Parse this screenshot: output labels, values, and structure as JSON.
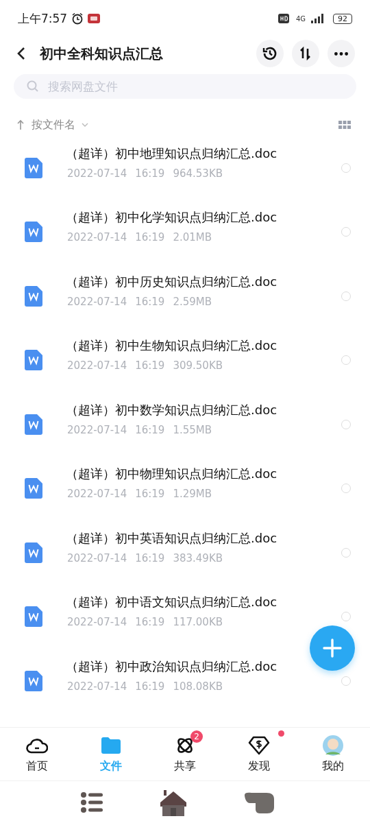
{
  "status_bar": {
    "time": "上午7:57",
    "network": "4G",
    "battery": "92"
  },
  "header": {
    "title": "初中全科知识点汇总"
  },
  "search": {
    "placeholder": "搜索网盘文件"
  },
  "sort": {
    "label": "按文件名"
  },
  "files": [
    {
      "name": "（超详）初中地理知识点归纳汇总.doc",
      "date": "2022-07-14",
      "time": "16:19",
      "size": "964.53KB",
      "selected": false
    },
    {
      "name": "（超详）初中化学知识点归纳汇总.doc",
      "date": "2022-07-14",
      "time": "16:19",
      "size": "2.01MB",
      "selected": false
    },
    {
      "name": "（超详）初中历史知识点归纳汇总.doc",
      "date": "2022-07-14",
      "time": "16:19",
      "size": "2.59MB",
      "selected": false
    },
    {
      "name": "（超详）初中生物知识点归纳汇总.doc",
      "date": "2022-07-14",
      "time": "16:19",
      "size": "309.50KB",
      "selected": false
    },
    {
      "name": "（超详）初中数学知识点归纳汇总.doc",
      "date": "2022-07-14",
      "time": "16:19",
      "size": "1.55MB",
      "selected": false
    },
    {
      "name": "（超详）初中物理知识点归纳汇总.doc",
      "date": "2022-07-14",
      "time": "16:19",
      "size": "1.29MB",
      "selected": false
    },
    {
      "name": "（超详）初中英语知识点归纳汇总.doc",
      "date": "2022-07-14",
      "time": "16:19",
      "size": "383.49KB",
      "selected": false
    },
    {
      "name": "（超详）初中语文知识点归纳汇总.doc",
      "date": "2022-07-14",
      "time": "16:19",
      "size": "117.00KB",
      "selected": false
    },
    {
      "name": "（超详）初中政治知识点归纳汇总.doc",
      "date": "2022-07-14",
      "time": "16:19",
      "size": "108.08KB",
      "selected": false
    }
  ],
  "tabs": [
    {
      "kind": "home",
      "label": "首页",
      "selected": false
    },
    {
      "kind": "files",
      "label": "文件",
      "selected": true
    },
    {
      "kind": "share",
      "label": "共享",
      "selected": false,
      "badge": "2"
    },
    {
      "kind": "discover",
      "label": "发现",
      "selected": false,
      "dot": true
    },
    {
      "kind": "me",
      "label": "我的",
      "selected": false
    }
  ]
}
